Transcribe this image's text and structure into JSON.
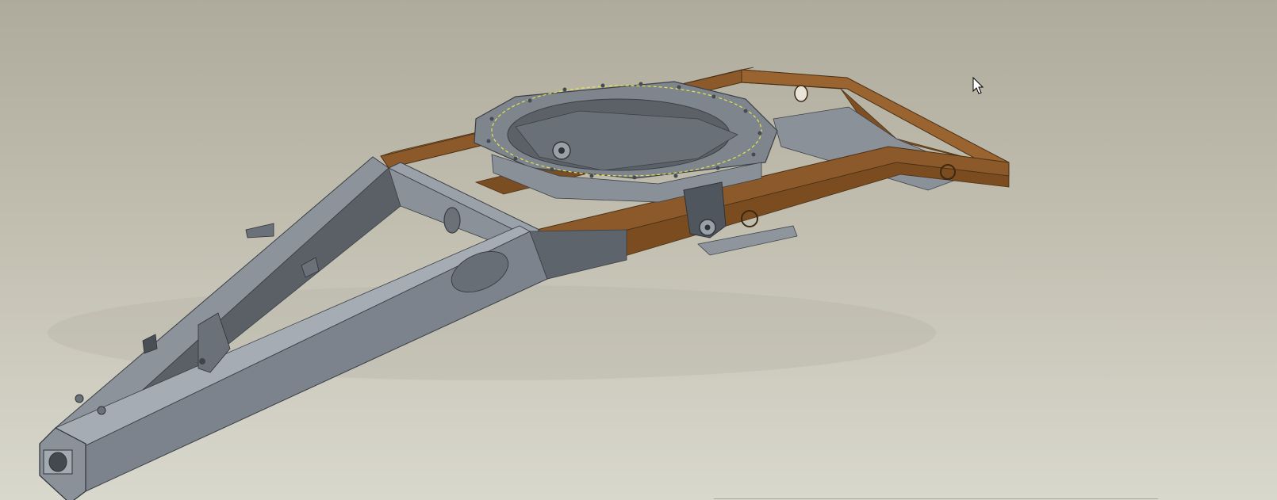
{
  "viewport": {
    "background_top": "#aeab9c",
    "background_bottom": "#d9d8cd"
  },
  "model": {
    "steel_color": "#7c838c",
    "steel_dark": "#4d5259",
    "steel_light": "#a5acb4",
    "orange_color": "#8c5a2a",
    "orange_light": "#b0763a",
    "highlight_color": "#e6e64a"
  },
  "icons": {
    "cursor": "mouse-pointer-icon"
  },
  "status": {
    "left_text": "",
    "right_text": ""
  }
}
